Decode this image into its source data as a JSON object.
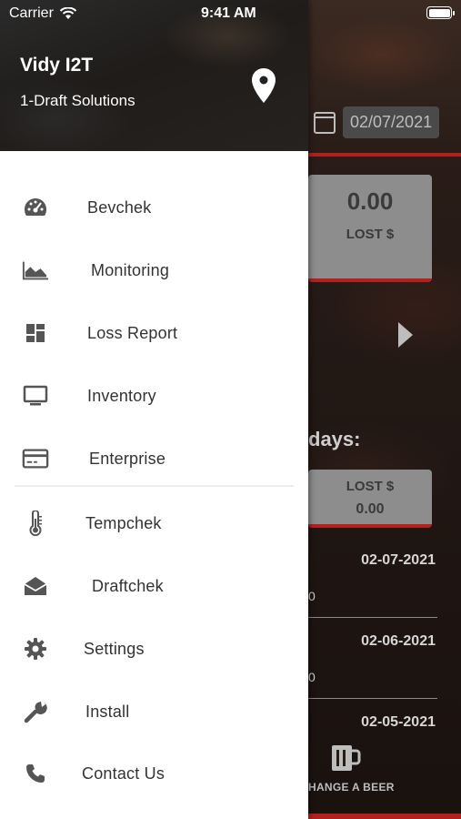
{
  "status_bar": {
    "carrier": "Carrier",
    "time": "9:41 AM"
  },
  "drawer": {
    "user_name": "Vidy I2T",
    "company": "1-Draft Solutions",
    "menu": [
      {
        "label": "Bevchek",
        "icon": "gauge-icon"
      },
      {
        "label": "Monitoring",
        "icon": "area-chart-icon"
      },
      {
        "label": "Loss Report",
        "icon": "dashboard-icon"
      },
      {
        "label": "Inventory",
        "icon": "monitor-icon"
      },
      {
        "label": "Enterprise",
        "icon": "credit-card-icon"
      },
      {
        "label": "Tempchek",
        "icon": "thermometer-icon"
      },
      {
        "label": "Draftchek",
        "icon": "open-envelope-icon"
      },
      {
        "label": "Settings",
        "icon": "gear-icon"
      },
      {
        "label": "Install",
        "icon": "wrench-icon"
      },
      {
        "label": "Contact Us",
        "icon": "phone-icon"
      }
    ]
  },
  "background": {
    "date": "02/07/2021",
    "stat_value": "0.00",
    "stat_label": "LOST $",
    "days_label": "days:",
    "summary_label": "LOST $",
    "summary_value": "0.00",
    "history": [
      {
        "date": "02-07-2021",
        "value": "0"
      },
      {
        "date": "02-06-2021",
        "value": "0"
      },
      {
        "date": "02-05-2021"
      }
    ],
    "bottom_action": "HANGE A BEER"
  }
}
